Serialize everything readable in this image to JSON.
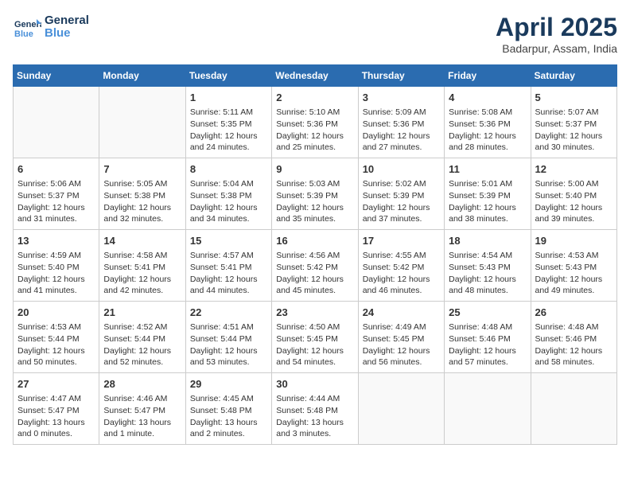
{
  "header": {
    "logo_line1": "General",
    "logo_line2": "Blue",
    "month_year": "April 2025",
    "location": "Badarpur, Assam, India"
  },
  "days_of_week": [
    "Sunday",
    "Monday",
    "Tuesday",
    "Wednesday",
    "Thursday",
    "Friday",
    "Saturday"
  ],
  "weeks": [
    [
      {
        "day": "",
        "info": ""
      },
      {
        "day": "",
        "info": ""
      },
      {
        "day": "1",
        "info": "Sunrise: 5:11 AM\nSunset: 5:35 PM\nDaylight: 12 hours and 24 minutes."
      },
      {
        "day": "2",
        "info": "Sunrise: 5:10 AM\nSunset: 5:36 PM\nDaylight: 12 hours and 25 minutes."
      },
      {
        "day": "3",
        "info": "Sunrise: 5:09 AM\nSunset: 5:36 PM\nDaylight: 12 hours and 27 minutes."
      },
      {
        "day": "4",
        "info": "Sunrise: 5:08 AM\nSunset: 5:36 PM\nDaylight: 12 hours and 28 minutes."
      },
      {
        "day": "5",
        "info": "Sunrise: 5:07 AM\nSunset: 5:37 PM\nDaylight: 12 hours and 30 minutes."
      }
    ],
    [
      {
        "day": "6",
        "info": "Sunrise: 5:06 AM\nSunset: 5:37 PM\nDaylight: 12 hours and 31 minutes."
      },
      {
        "day": "7",
        "info": "Sunrise: 5:05 AM\nSunset: 5:38 PM\nDaylight: 12 hours and 32 minutes."
      },
      {
        "day": "8",
        "info": "Sunrise: 5:04 AM\nSunset: 5:38 PM\nDaylight: 12 hours and 34 minutes."
      },
      {
        "day": "9",
        "info": "Sunrise: 5:03 AM\nSunset: 5:39 PM\nDaylight: 12 hours and 35 minutes."
      },
      {
        "day": "10",
        "info": "Sunrise: 5:02 AM\nSunset: 5:39 PM\nDaylight: 12 hours and 37 minutes."
      },
      {
        "day": "11",
        "info": "Sunrise: 5:01 AM\nSunset: 5:39 PM\nDaylight: 12 hours and 38 minutes."
      },
      {
        "day": "12",
        "info": "Sunrise: 5:00 AM\nSunset: 5:40 PM\nDaylight: 12 hours and 39 minutes."
      }
    ],
    [
      {
        "day": "13",
        "info": "Sunrise: 4:59 AM\nSunset: 5:40 PM\nDaylight: 12 hours and 41 minutes."
      },
      {
        "day": "14",
        "info": "Sunrise: 4:58 AM\nSunset: 5:41 PM\nDaylight: 12 hours and 42 minutes."
      },
      {
        "day": "15",
        "info": "Sunrise: 4:57 AM\nSunset: 5:41 PM\nDaylight: 12 hours and 44 minutes."
      },
      {
        "day": "16",
        "info": "Sunrise: 4:56 AM\nSunset: 5:42 PM\nDaylight: 12 hours and 45 minutes."
      },
      {
        "day": "17",
        "info": "Sunrise: 4:55 AM\nSunset: 5:42 PM\nDaylight: 12 hours and 46 minutes."
      },
      {
        "day": "18",
        "info": "Sunrise: 4:54 AM\nSunset: 5:43 PM\nDaylight: 12 hours and 48 minutes."
      },
      {
        "day": "19",
        "info": "Sunrise: 4:53 AM\nSunset: 5:43 PM\nDaylight: 12 hours and 49 minutes."
      }
    ],
    [
      {
        "day": "20",
        "info": "Sunrise: 4:53 AM\nSunset: 5:44 PM\nDaylight: 12 hours and 50 minutes."
      },
      {
        "day": "21",
        "info": "Sunrise: 4:52 AM\nSunset: 5:44 PM\nDaylight: 12 hours and 52 minutes."
      },
      {
        "day": "22",
        "info": "Sunrise: 4:51 AM\nSunset: 5:44 PM\nDaylight: 12 hours and 53 minutes."
      },
      {
        "day": "23",
        "info": "Sunrise: 4:50 AM\nSunset: 5:45 PM\nDaylight: 12 hours and 54 minutes."
      },
      {
        "day": "24",
        "info": "Sunrise: 4:49 AM\nSunset: 5:45 PM\nDaylight: 12 hours and 56 minutes."
      },
      {
        "day": "25",
        "info": "Sunrise: 4:48 AM\nSunset: 5:46 PM\nDaylight: 12 hours and 57 minutes."
      },
      {
        "day": "26",
        "info": "Sunrise: 4:48 AM\nSunset: 5:46 PM\nDaylight: 12 hours and 58 minutes."
      }
    ],
    [
      {
        "day": "27",
        "info": "Sunrise: 4:47 AM\nSunset: 5:47 PM\nDaylight: 13 hours and 0 minutes."
      },
      {
        "day": "28",
        "info": "Sunrise: 4:46 AM\nSunset: 5:47 PM\nDaylight: 13 hours and 1 minute."
      },
      {
        "day": "29",
        "info": "Sunrise: 4:45 AM\nSunset: 5:48 PM\nDaylight: 13 hours and 2 minutes."
      },
      {
        "day": "30",
        "info": "Sunrise: 4:44 AM\nSunset: 5:48 PM\nDaylight: 13 hours and 3 minutes."
      },
      {
        "day": "",
        "info": ""
      },
      {
        "day": "",
        "info": ""
      },
      {
        "day": "",
        "info": ""
      }
    ]
  ]
}
